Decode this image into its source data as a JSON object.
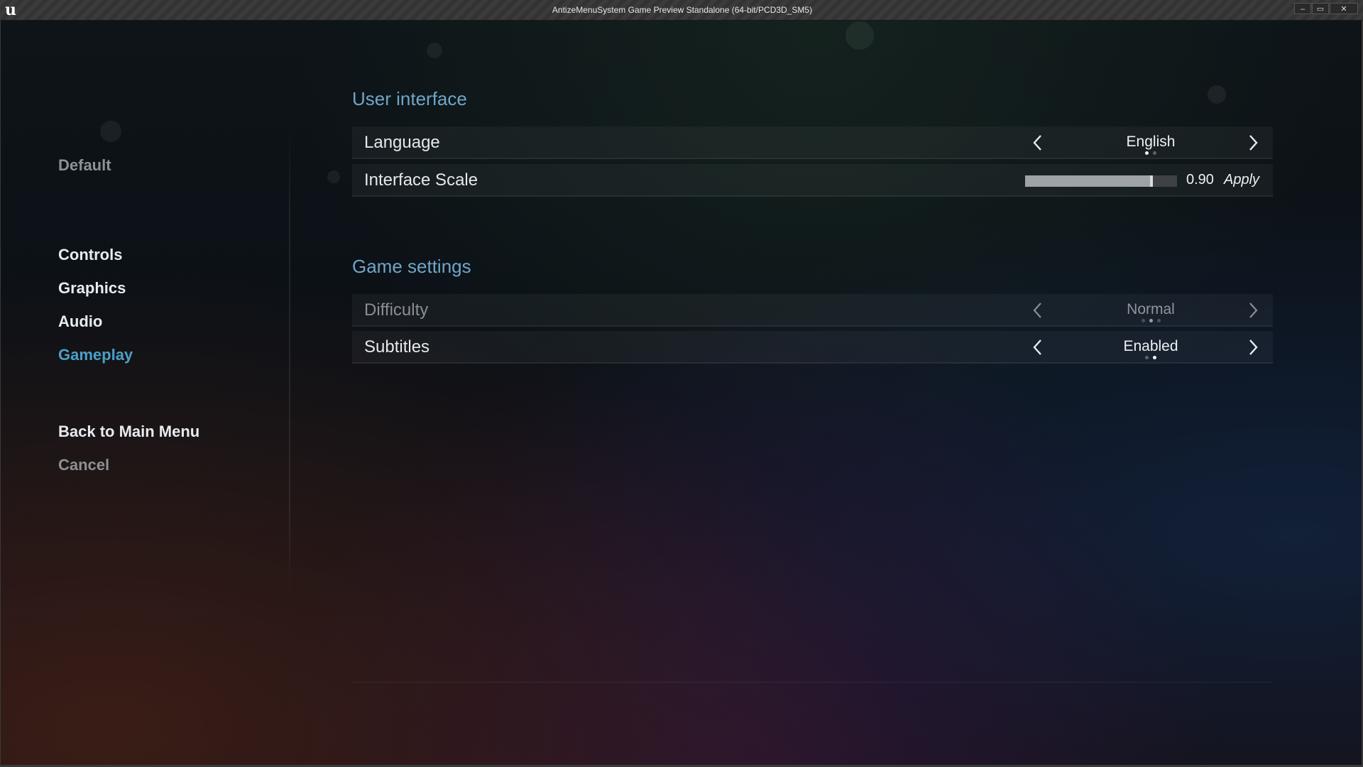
{
  "window": {
    "title": "AntizeMenuSystem Game Preview Standalone (64-bit/PCD3D_SM5)",
    "logo": "u",
    "buttons": {
      "minimize": "–",
      "maximize": "▭",
      "close": "✕"
    }
  },
  "sidebar": {
    "default_label": "Default",
    "items": [
      {
        "label": "Controls",
        "state": "normal"
      },
      {
        "label": "Graphics",
        "state": "normal"
      },
      {
        "label": "Audio",
        "state": "normal"
      },
      {
        "label": "Gameplay",
        "state": "active"
      }
    ],
    "back_label": "Back to Main Menu",
    "cancel_label": "Cancel",
    "colors": {
      "active": "#4aa0c8",
      "normal": "#e8ecef",
      "muted": "#8c9196"
    }
  },
  "sections": {
    "user_interface": {
      "title": "User interface",
      "language": {
        "label": "Language",
        "value": "English",
        "option_count": 2,
        "selected_index": 0
      },
      "interface_scale": {
        "label": "Interface Scale",
        "value": "0.90",
        "slider_fraction": 0.83,
        "apply_label": "Apply"
      }
    },
    "game_settings": {
      "title": "Game settings",
      "difficulty": {
        "label": "Difficulty",
        "value": "Normal",
        "enabled": false,
        "option_count": 3,
        "selected_index": 1
      },
      "subtitles": {
        "label": "Subtitles",
        "value": "Enabled",
        "option_count": 2,
        "selected_index": 1
      }
    }
  },
  "icons": {
    "prev": "chevron-left-icon",
    "next": "chevron-right-icon",
    "logo": "unreal-logo-icon"
  }
}
